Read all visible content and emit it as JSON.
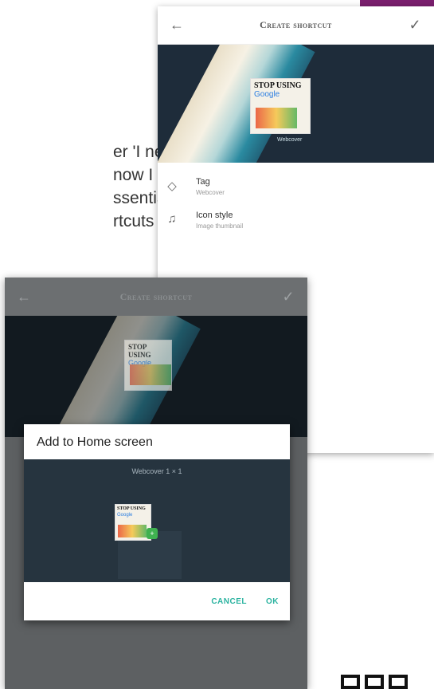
{
  "article": {
    "lines": [
      "er 'I never",
      "now I can't",
      "ssentially",
      "rtcuts for"
    ]
  },
  "screen1": {
    "title": "Create shortcut",
    "back_icon": "arrow-left-icon",
    "confirm_icon": "check-icon",
    "preview": {
      "cover_title": "STOP USING",
      "cover_google": "Google",
      "caption": "Webcover"
    },
    "rows": [
      {
        "icon": "tag-icon",
        "title": "Tag",
        "subtitle": "Webcover"
      },
      {
        "icon": "bell-icon",
        "title": "Icon style",
        "subtitle": "Image thumbnail"
      }
    ]
  },
  "screen2": {
    "title": "Create shortcut",
    "back_icon": "arrow-left-icon",
    "confirm_icon": "check-icon",
    "preview": {
      "cover_title": "STOP USING",
      "cover_google": "Google"
    },
    "dialog": {
      "title": "Add to Home screen",
      "widget_label": "Webcover 1 × 1",
      "cover_title": "STOP USING",
      "cover_google": "Google",
      "badge": "+",
      "cancel_label": "CANCEL",
      "ok_label": "OK"
    }
  },
  "colors": {
    "accent": "#2bb3a0",
    "magazine_tab": "#7a1f6e",
    "dialog_body": "#26343f"
  }
}
